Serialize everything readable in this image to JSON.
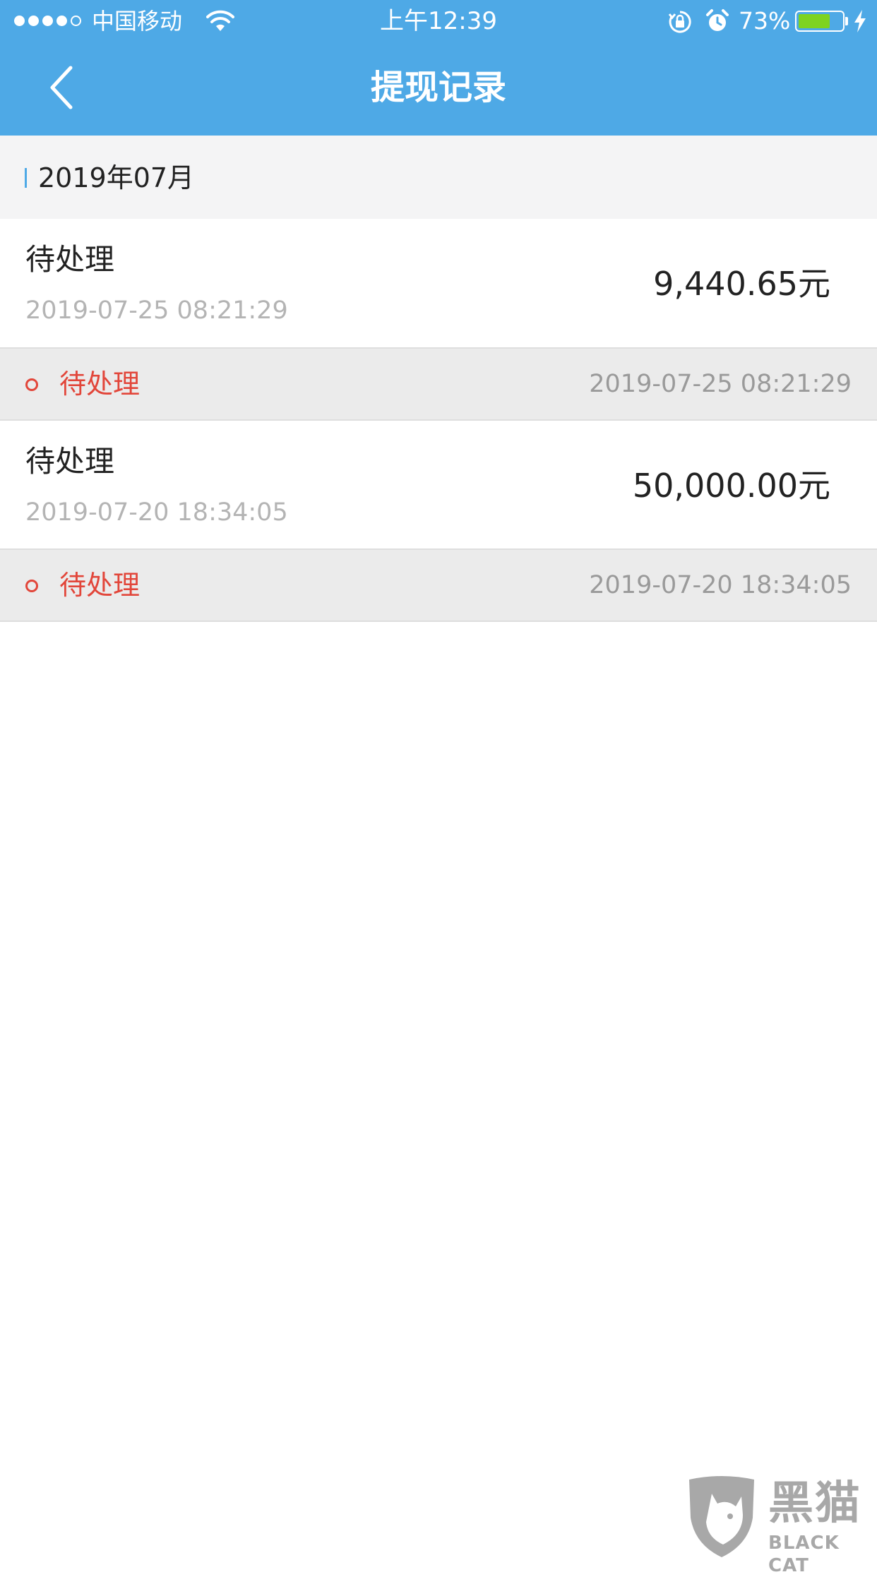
{
  "status_bar": {
    "carrier": "中国移动",
    "time": "上午12:39",
    "battery_percent": "73%",
    "battery_level": 0.73,
    "signal_bars_filled": 4,
    "signal_bars_total": 5
  },
  "nav": {
    "title": "提现记录",
    "back_icon": "chevron-left-icon"
  },
  "month_group": {
    "label": "2019年07月",
    "accent_color": "#4ea9e6"
  },
  "records": [
    {
      "status": "待处理",
      "time": "2019-07-25 08:21:29",
      "amount": "9,440.65元",
      "detail_status": "待处理",
      "detail_time": "2019-07-25 08:21:29"
    },
    {
      "status": "待处理",
      "time": "2019-07-20 18:34:05",
      "amount": "50,000.00元",
      "detail_status": "待处理",
      "detail_time": "2019-07-20 18:34:05"
    }
  ],
  "colors": {
    "header_bg": "#4ea9e6",
    "pending_red": "#e2463a",
    "battery_green": "#7ed321"
  },
  "watermark": {
    "chars": "黑猫",
    "latin": "BLACK CAT"
  }
}
